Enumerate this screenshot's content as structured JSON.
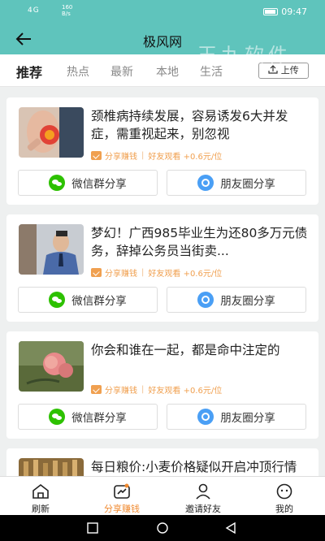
{
  "status": {
    "signal": "4G",
    "speed_top": "160",
    "speed_bottom": "B/s",
    "time": "09:47"
  },
  "header": {
    "title": "极风网",
    "back_icon": "arrow-left-icon"
  },
  "watermark": "玉九软件",
  "tabs": [
    {
      "label": "推荐",
      "active": true
    },
    {
      "label": "热点",
      "active": false
    },
    {
      "label": "最新",
      "active": false
    },
    {
      "label": "本地",
      "active": false
    },
    {
      "label": "生活",
      "active": false
    }
  ],
  "upload_label": "上传",
  "articles": [
    {
      "headline": "颈椎病持续发展，容易诱发6大并发症，需重视起来，别忽视",
      "earn_label": "分享赚钱",
      "friend_label": "好友观看",
      "reward": "+0.6元/位",
      "wechat_label": "微信群分享",
      "moments_label": "朋友圈分享"
    },
    {
      "headline": "梦幻！广西985毕业生为还80多万元债务，辞掉公务员当街卖...",
      "earn_label": "分享赚钱",
      "friend_label": "好友观看",
      "reward": "+0.6元/位",
      "wechat_label": "微信群分享",
      "moments_label": "朋友圈分享"
    },
    {
      "headline": "你会和谁在一起，都是命中注定的",
      "earn_label": "分享赚钱",
      "friend_label": "好友观看",
      "reward": "+0.6元/位",
      "wechat_label": "微信群分享",
      "moments_label": "朋友圈分享"
    },
    {
      "headline": "每日粮价:小麦价格疑似开启冲顶行情 玉米下跌步伐加速"
    }
  ],
  "tabbar": [
    {
      "label": "刷新",
      "icon": "home-icon",
      "active": false
    },
    {
      "label": "分享赚钱",
      "icon": "share-money-icon",
      "active": true
    },
    {
      "label": "邀请好友",
      "icon": "person-icon",
      "active": false
    },
    {
      "label": "我的",
      "icon": "smiley-icon",
      "active": false
    }
  ],
  "colors": {
    "header": "#5fc4bc",
    "accent": "#f08a30",
    "wechat": "#2dc100",
    "moments": "#4a9ff5"
  }
}
